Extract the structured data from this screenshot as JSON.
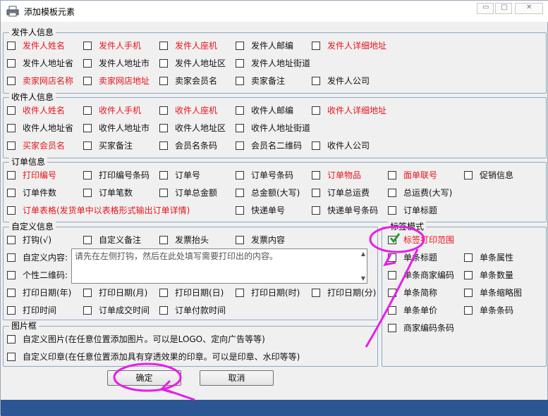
{
  "window": {
    "title": "添加模板元素"
  },
  "sender": {
    "legend": "发件人信息",
    "items": [
      {
        "label": "发件人姓名"
      },
      {
        "label": "发件人手机"
      },
      {
        "label": "发件人座机"
      },
      {
        "label": "发件人邮编"
      },
      {
        "label": "发件人详细地址"
      },
      {
        "label": "发件人地址省"
      },
      {
        "label": "发件人地址市"
      },
      {
        "label": "发件人地址区"
      },
      {
        "label": "发件人地址街道"
      },
      {
        "label": "卖家网店名称"
      },
      {
        "label": "卖家网店地址"
      },
      {
        "label": "卖家会员名"
      },
      {
        "label": "卖家备注"
      },
      {
        "label": "发件人公司"
      }
    ]
  },
  "receiver": {
    "legend": "收件人信息",
    "items": [
      {
        "label": "收件人姓名"
      },
      {
        "label": "收件人手机"
      },
      {
        "label": "收件人座机"
      },
      {
        "label": "收件人邮编"
      },
      {
        "label": "收件人详细地址"
      },
      {
        "label": "收件人地址省"
      },
      {
        "label": "收件人地址市"
      },
      {
        "label": "收件人地址区"
      },
      {
        "label": "收件人地址街道"
      },
      {
        "label": "买家会员名"
      },
      {
        "label": "买家备注"
      },
      {
        "label": "会员名条码"
      },
      {
        "label": "会员名二维码"
      },
      {
        "label": "收件人公司"
      }
    ]
  },
  "order": {
    "legend": "订单信息",
    "items": [
      {
        "label": "打印编号"
      },
      {
        "label": "打印编号条码"
      },
      {
        "label": "订单号"
      },
      {
        "label": "订单号条码"
      },
      {
        "label": "订单物品"
      },
      {
        "label": "面单联号"
      },
      {
        "label": "促销信息"
      },
      {
        "label": "订单件数"
      },
      {
        "label": "订单笔数"
      },
      {
        "label": "订单总金额"
      },
      {
        "label": "总金额(大写)"
      },
      {
        "label": "订单总运费"
      },
      {
        "label": "总运费(大写)"
      },
      {
        "label": "订单表格(发货单中以表格形式输出订单详情)"
      },
      {
        "label": "快递单号"
      },
      {
        "label": "快递单号条码"
      },
      {
        "label": "订单标题"
      }
    ]
  },
  "custom": {
    "legend": "自定义信息",
    "items": [
      {
        "label": "打钩(√)"
      },
      {
        "label": "自定义备注"
      },
      {
        "label": "发票抬头"
      },
      {
        "label": "发票内容"
      },
      {
        "label": "自定义内容:"
      },
      {
        "label": "个性二维码:"
      },
      {
        "label": "打印日期(年)"
      },
      {
        "label": "打印日期(月)"
      },
      {
        "label": "打印日期(日)"
      },
      {
        "label": "打印日期(时)"
      },
      {
        "label": "打印日期(分)"
      },
      {
        "label": "打印时间"
      },
      {
        "label": "订单成交时间"
      },
      {
        "label": "订单付款时间"
      }
    ],
    "textarea_value": "请先在左侧打钩，然后在此处填写需要打印出的内容。"
  },
  "picture": {
    "legend": "图片框",
    "items": [
      {
        "label": "自定义图片(在任意位置添加图片。可以是LOGO、定向广告等等)"
      },
      {
        "label": "自定义印章(在任意位置添加具有穿透效果的印章。可以是印章、水印等等)"
      }
    ]
  },
  "label_mode": {
    "legend": "标签模式",
    "items": [
      {
        "label": "标签打印范围",
        "checked": true
      },
      {
        "label": "单条标题"
      },
      {
        "label": "单条属性"
      },
      {
        "label": "单条商家编码"
      },
      {
        "label": "单条数量"
      },
      {
        "label": "单条简称"
      },
      {
        "label": "单条缩略图"
      },
      {
        "label": "单条单价"
      },
      {
        "label": "单条条码"
      },
      {
        "label": "商家编码条码"
      }
    ]
  },
  "buttons": {
    "ok": "确定",
    "cancel": "取消"
  },
  "colors": {
    "required_red": "#e8141b",
    "annotation_magenta": "#e81ee8",
    "check_green": "#2a9a2a",
    "status_blue": "#2c5593"
  }
}
